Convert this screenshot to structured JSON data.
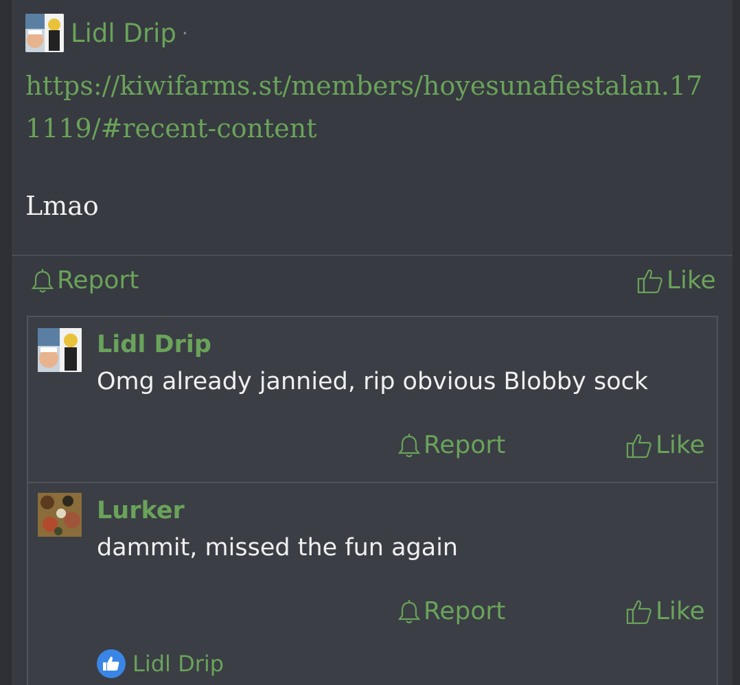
{
  "post": {
    "author": "Lidl Drip",
    "separator": "·",
    "link": "https://kiwifarms.st/members/hoyesunafiestalan.171119/#recent-content",
    "text": "Lmao",
    "report_label": "Report",
    "like_label": "Like"
  },
  "comments": [
    {
      "author": "Lidl Drip",
      "text": "Omg already jannied, rip obvious Blobby sock",
      "report_label": "Report",
      "like_label": "Like"
    },
    {
      "author": "Lurker",
      "text": "dammit, missed the fun again",
      "report_label": "Report",
      "like_label": "Like"
    }
  ],
  "liked_by": {
    "name": "Lidl Drip",
    "icon": "thumbs-up-icon"
  },
  "colors": {
    "accent": "#6aa35a",
    "background": "#373a40",
    "comment_background": "#3b3e45",
    "text": "#f0f0f0",
    "like_badge": "#3a86e6"
  }
}
